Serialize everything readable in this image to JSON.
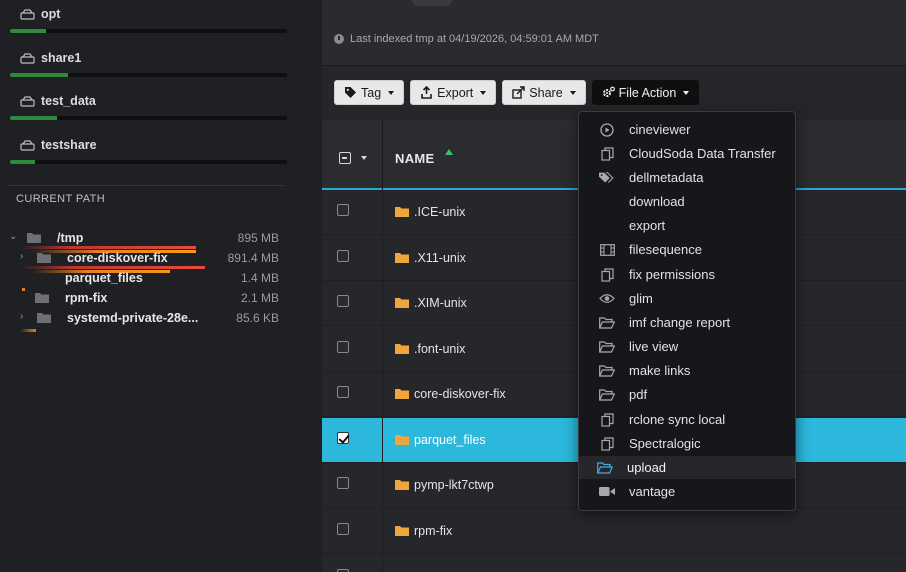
{
  "sidebar": {
    "storages": [
      {
        "label": "opt",
        "usage": 0.13
      },
      {
        "label": "share1",
        "usage": 0.21
      },
      {
        "label": "test_data",
        "usage": 0.17
      },
      {
        "label": "testshare",
        "usage": 0.09
      }
    ],
    "current_path_label": "CURRENT PATH",
    "tree": [
      {
        "name": "/tmp",
        "size": "895 MB",
        "expanded": true
      },
      {
        "name": "core-diskover-fix",
        "size": "891.4 MB",
        "expandable": true
      },
      {
        "name": "parquet_files",
        "size": "1.4 MB"
      },
      {
        "name": "rpm-fix",
        "size": "2.1 MB"
      },
      {
        "name": "systemd-private-28e...",
        "size": "85.6 KB",
        "expandable": true
      }
    ]
  },
  "main": {
    "last_indexed": "Last indexed tmp at 04/19/2026, 04:59:01 AM MDT",
    "toolbar": {
      "tag": "Tag",
      "export": "Export",
      "share": "Share",
      "file_action": "File Action"
    },
    "table": {
      "name_header": "NAME",
      "rows": [
        {
          "name": ".ICE-unix",
          "selected": false
        },
        {
          "name": ".X11-unix",
          "selected": false
        },
        {
          "name": ".XIM-unix",
          "selected": false
        },
        {
          "name": ".font-unix",
          "selected": false
        },
        {
          "name": "core-diskover-fix",
          "selected": false
        },
        {
          "name": "parquet_files",
          "selected": true
        },
        {
          "name": "pymp-lkt7ctwp",
          "selected": false
        },
        {
          "name": "rpm-fix",
          "selected": false
        }
      ]
    }
  },
  "file_action_menu": {
    "items": [
      {
        "label": "cineviewer",
        "icon": "play-circle-icon"
      },
      {
        "label": "CloudSoda Data Transfer",
        "icon": "copy-icon"
      },
      {
        "label": "dellmetadata",
        "icon": "tags-icon"
      },
      {
        "label": "download",
        "icon": ""
      },
      {
        "label": "export",
        "icon": ""
      },
      {
        "label": "filesequence",
        "icon": "film-icon"
      },
      {
        "label": "fix permissions",
        "icon": "copy-icon"
      },
      {
        "label": "glim",
        "icon": "eye-icon"
      },
      {
        "label": "imf change report",
        "icon": "folder-open-icon"
      },
      {
        "label": "live view",
        "icon": "folder-open-icon"
      },
      {
        "label": "make links",
        "icon": "folder-open-icon"
      },
      {
        "label": "pdf",
        "icon": "folder-open-icon"
      },
      {
        "label": "rclone sync local",
        "icon": "copy-icon"
      },
      {
        "label": "Spectralogic",
        "icon": "copy-icon"
      },
      {
        "label": "upload",
        "icon": "folder-open-icon",
        "active": true
      },
      {
        "label": "vantage",
        "icon": "video-icon"
      }
    ]
  },
  "colors": {
    "accent": "#2bb8dc",
    "usage_bar": "#2e8b3e",
    "folder": "#f0a63a",
    "sort_arrow": "#3fbf6c"
  }
}
